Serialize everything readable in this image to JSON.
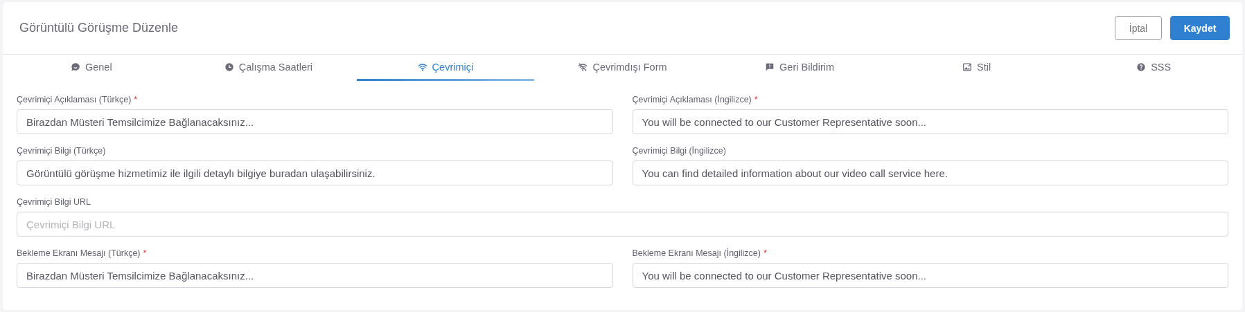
{
  "header": {
    "title": "Görüntülü Görüşme Düzenle",
    "buttons": [
      {
        "kind": "secondary",
        "label": "İptal"
      },
      {
        "kind": "primary",
        "label": "Kaydet"
      }
    ]
  },
  "tabs": [
    {
      "label": "Genel",
      "selected": false
    },
    {
      "label": "Çalışma Saatleri",
      "selected": false
    },
    {
      "label": "Çevrimiçi",
      "selected": true
    },
    {
      "label": "Çevrimdışı Form",
      "selected": false
    },
    {
      "label": "Geri Bildirim",
      "selected": false
    },
    {
      "label": "Stil",
      "selected": false
    },
    {
      "label": "SSS",
      "selected": false
    }
  ],
  "form_rows": [
    {
      "fields": [
        {
          "label": "Çevrimiçi Açıklaması (Türkçe)",
          "required_mark": "*",
          "value": "Birazdan Müsteri Temsilcimize Bağlanacaksınız..."
        },
        {
          "label": "Çevrimiçi Açıklaması (İngilizce)",
          "required_mark": "*",
          "value": "You will be connected to our Customer Representative soon..."
        }
      ]
    },
    {
      "fields": [
        {
          "label": "Çevrimiçi Bilgi (Türkçe)",
          "value": "Görüntülü görüşme hizmetimiz ile ilgili detaylı bilgiye buradan ulaşabilirsiniz."
        },
        {
          "label": "Çevrimiçi Bilgi (İngilizce)",
          "value": "You can find detailed information about our video call service here."
        }
      ]
    },
    {
      "fields": [
        {
          "label": "Çevrimiçi Bilgi URL",
          "placeholder": "Çevrimiçi Bilgi URL"
        }
      ]
    },
    {
      "fields": [
        {
          "label": "Bekleme Ekranı Mesajı (Türkçe)",
          "required_mark": "*",
          "value": "Birazdan Müsteri Temsilcimize Bağlanacaksınız..."
        },
        {
          "label": "Bekleme Ekranı Mesajı (İngilizce)",
          "required_mark": "*",
          "value": "You will be connected to our Customer Representative soon..."
        }
      ]
    }
  ]
}
